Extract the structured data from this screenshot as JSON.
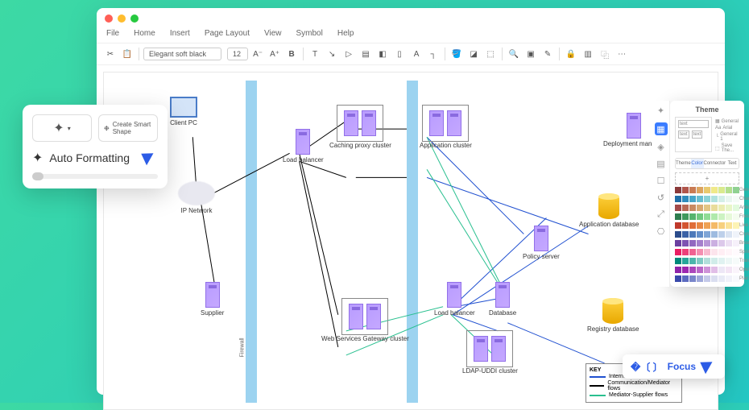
{
  "menu": {
    "file": "File",
    "home": "Home",
    "insert": "Insert",
    "pageLayout": "Page Layout",
    "view": "View",
    "symbol": "Symbol",
    "help": "Help"
  },
  "toolbar": {
    "font": "Elegant soft black",
    "size": "12"
  },
  "promo": {
    "createSmart": "Create Smart Shape",
    "autoFormat": "Auto Formatting"
  },
  "theme": {
    "title": "Theme",
    "opts": {
      "general": "General",
      "arial": "Arial",
      "general1": "General 1",
      "save": "Save The..."
    },
    "tabs": {
      "theme": "Theme",
      "color": "Color",
      "connector": "Connector",
      "text": "Text"
    },
    "swatches": [
      {
        "name": "General",
        "colors": [
          "#8b3a3a",
          "#b0554a",
          "#c97b53",
          "#dca45f",
          "#e8c96f",
          "#f0e989",
          "#d9ea8e",
          "#b3df8e",
          "#8fd191"
        ]
      },
      {
        "name": "Charm",
        "colors": [
          "#1f6fa8",
          "#2f8bbc",
          "#45a6c9",
          "#66bed1",
          "#8ad2d8",
          "#b0e2df",
          "#d4efe8",
          "#e9f6f0",
          "#f5fbf7"
        ]
      },
      {
        "name": "Antique",
        "colors": [
          "#a24a4a",
          "#b86a55",
          "#c98a62",
          "#d7a972",
          "#e2c585",
          "#e9dc9b",
          "#ebedb2",
          "#e8f6c8",
          "#e2fadd"
        ]
      },
      {
        "name": "Fresh",
        "colors": [
          "#2e7d4f",
          "#3f9a5d",
          "#55b46d",
          "#70ca80",
          "#8fdc95",
          "#afe9ab",
          "#cdf3c2",
          "#e6f9d9",
          "#f4fcef"
        ]
      },
      {
        "name": "Live",
        "colors": [
          "#c0392b",
          "#d35430",
          "#e06e38",
          "#e88844",
          "#efa154",
          "#f4ba68",
          "#f7d07f",
          "#fae399",
          "#fdf3b5"
        ]
      },
      {
        "name": "Crystal",
        "colors": [
          "#2b4c8c",
          "#3a62a6",
          "#4c79ba",
          "#638fca",
          "#7fa5d6",
          "#9ebbe0",
          "#bdd0ea",
          "#d9e3f2",
          "#eff3fa"
        ]
      },
      {
        "name": "Broad",
        "colors": [
          "#6b3fa0",
          "#7e52b2",
          "#9268c0",
          "#a57fcc",
          "#b897d7",
          "#cbafe1",
          "#dcc8ea",
          "#ebdff3",
          "#f6f0fa"
        ]
      },
      {
        "name": "Sprinkle",
        "colors": [
          "#e91e63",
          "#ec407a",
          "#f06292",
          "#f48fb1",
          "#f8bbd0",
          "#fce4ec",
          "#ffeef4",
          "#fff5f9",
          "#fffafd"
        ]
      },
      {
        "name": "Tranquil",
        "colors": [
          "#00897b",
          "#26a69a",
          "#4db6ac",
          "#80cbc4",
          "#b2dfdb",
          "#d0ece9",
          "#e0f2f1",
          "#edf7f6",
          "#f6fbfa"
        ]
      },
      {
        "name": "Opulent",
        "colors": [
          "#8e24aa",
          "#9c27b0",
          "#ab47bc",
          "#ba68c8",
          "#ce93d8",
          "#e1bee7",
          "#ede7f6",
          "#f3e5f5",
          "#faf4fb"
        ]
      },
      {
        "name": "Placid",
        "colors": [
          "#3949ab",
          "#5c6bc0",
          "#7986cb",
          "#9fa8da",
          "#c5cae9",
          "#dadef0",
          "#e8eaf6",
          "#f1f2fa",
          "#f8f9fd"
        ]
      }
    ]
  },
  "focus": {
    "label": "Focus"
  },
  "key": {
    "title": "KEY",
    "internet": "Internet",
    "comm": "Communication/Mediator flows",
    "med": "Mediator-Supplier flows"
  },
  "nodes": {
    "clientpc": "Client PC",
    "ipnet": "IP Network",
    "supplier": "Supplier",
    "lb1": "Load balancer",
    "caching": "Caching proxy cluster",
    "appcluster": "Application cluster",
    "wsg": "Web Services Gateway cluster",
    "lb2": "Load balancer",
    "database": "Database",
    "ldap": "LDAP-UDDI cluster",
    "deploy": "Deployment manager",
    "policy": "Policy server",
    "appdb": "Application database",
    "regdb": "Registry database"
  }
}
